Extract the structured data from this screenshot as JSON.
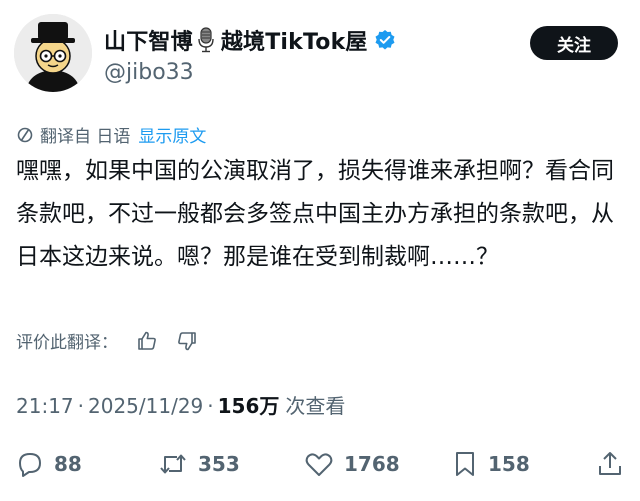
{
  "author": {
    "name_part1": "山下智博",
    "name_part2": "越境TikTok屋",
    "handle": "@jibo33",
    "mic_icon": "microphone-icon",
    "verified_icon": "verified-badge-icon",
    "verified_color": "#1d9bf0"
  },
  "follow_button": {
    "label": "关注"
  },
  "translation": {
    "icon": "translate-icon",
    "label": "翻译自 日语",
    "show_original": "显示原文"
  },
  "tweet": {
    "text": "嘿嘿，如果中国的公演取消了，损失得谁来承担啊？看合同条款吧，不过一般都会多签点中国主办方承担的条款吧，从日本这边来说。嗯？那是谁在受到制裁啊……？"
  },
  "rate_translation": {
    "label": "评价此翻译：",
    "like_icon": "thumbs-up-icon",
    "dislike_icon": "thumbs-down-icon"
  },
  "meta": {
    "time": "21:17",
    "date": "2025/11/29",
    "separator": "·",
    "views_count": "156万",
    "views_label": "次查看"
  },
  "actions": {
    "reply": {
      "icon": "reply-icon",
      "count": "88"
    },
    "repost": {
      "icon": "repost-icon",
      "count": "353"
    },
    "like": {
      "icon": "heart-icon",
      "count": "1768"
    },
    "bookmark": {
      "icon": "bookmark-icon",
      "count": "158"
    },
    "share": {
      "icon": "share-icon"
    }
  },
  "colors": {
    "text": "#0f1419",
    "secondary": "#536471",
    "accent": "#1d9bf0",
    "button_bg": "#0f1419"
  }
}
